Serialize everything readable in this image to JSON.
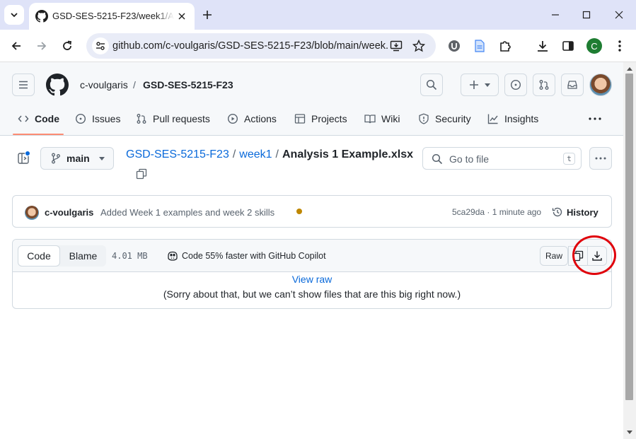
{
  "browser": {
    "tab_title": "GSD-SES-5215-F23/week1/Analysis 1 Example.xlsx",
    "url": "github.com/c-voulgaris/GSD-SES-5215-F23/blob/main/week...",
    "profile_initial": "C"
  },
  "header": {
    "owner": "c-voulgaris",
    "separator": "/",
    "repo": "GSD-SES-5215-F23"
  },
  "nav": [
    {
      "label": "Code",
      "icon": "code-icon"
    },
    {
      "label": "Issues",
      "icon": "issue-icon"
    },
    {
      "label": "Pull requests",
      "icon": "pull-request-icon"
    },
    {
      "label": "Actions",
      "icon": "play-icon"
    },
    {
      "label": "Projects",
      "icon": "table-icon"
    },
    {
      "label": "Wiki",
      "icon": "book-icon"
    },
    {
      "label": "Security",
      "icon": "shield-icon"
    },
    {
      "label": "Insights",
      "icon": "graph-icon"
    }
  ],
  "file_nav": {
    "branch": "main",
    "path": [
      "GSD-SES-5215-F23",
      "week1"
    ],
    "path_sep": "/",
    "file_name": "Analysis 1 Example.xlsx",
    "goto_placeholder": "Go to file",
    "goto_shortcut": "t"
  },
  "commit": {
    "author": "c-voulgaris",
    "message": "Added Week 1 examples and week 2 skills",
    "sha_time": "5ca29da · 1 minute ago",
    "history_label": "History",
    "status_color": "#bf8700"
  },
  "file": {
    "tab_code": "Code",
    "tab_blame": "Blame",
    "size": "4.01 MB",
    "copilot_text": "Code 55% faster with GitHub Copilot",
    "raw_label": "Raw",
    "view_raw": "View raw",
    "too_big": "(Sorry about that, but we can’t show files that are this big right now.)"
  },
  "colors": {
    "accent_link": "#0969da",
    "nav_underline": "#fd8c73",
    "annotation_circle": "#e0000a"
  }
}
